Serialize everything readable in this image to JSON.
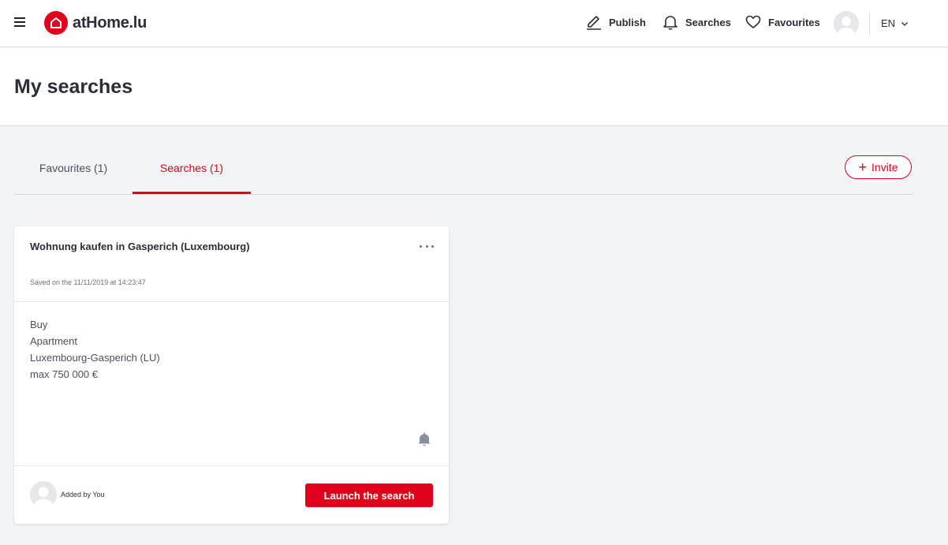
{
  "header": {
    "brand": "atHome.lu",
    "nav": {
      "publish": "Publish",
      "searches": "Searches",
      "favourites": "Favourites"
    },
    "language": "EN"
  },
  "page": {
    "title": "My searches"
  },
  "tabs": [
    {
      "label": "Favourites (1)",
      "active": false
    },
    {
      "label": "Searches (1)",
      "active": true
    }
  ],
  "invite_label": "Invite",
  "card": {
    "title": "Wohnung kaufen in Gasperich (Luxembourg)",
    "saved": "Saved on the 11/11/2019 at 14:23:47",
    "criteria": [
      "Buy",
      "Apartment",
      "Luxembourg-Gasperich (LU)",
      "max 750 000 €"
    ],
    "added_by": "Added by You",
    "launch_label": "Launch the search"
  },
  "colors": {
    "accent": "#e0001b",
    "background": "#f3f4f6",
    "text": "#2a2e36"
  }
}
